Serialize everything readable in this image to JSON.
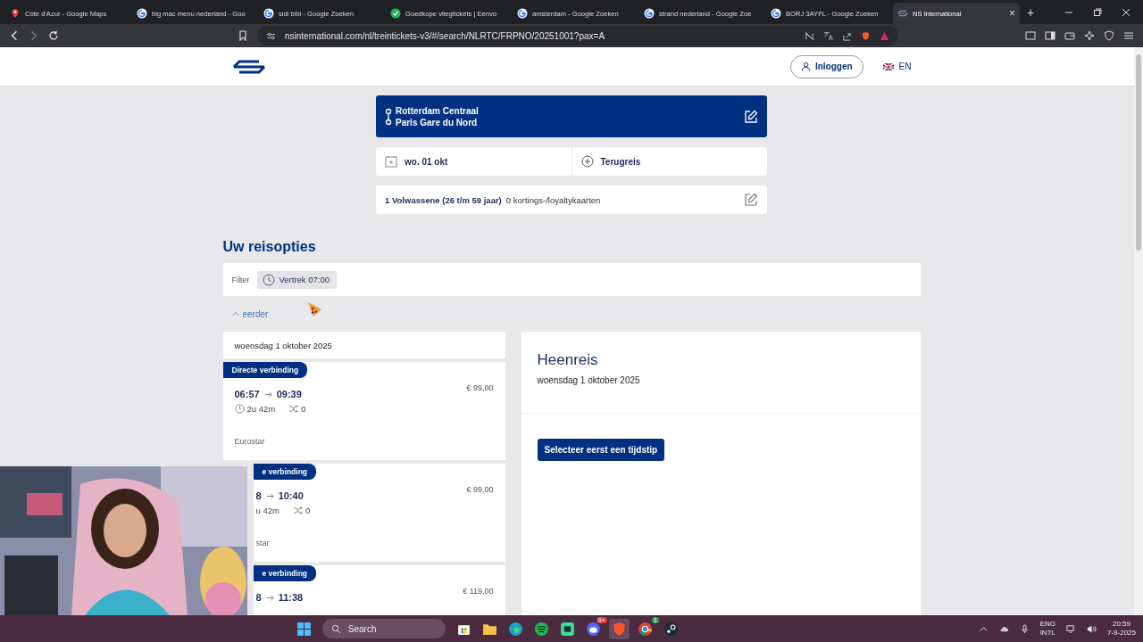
{
  "browser": {
    "tabs": [
      {
        "kind": "maps",
        "title": "Côte d'Azur - Google Maps",
        "selected": false
      },
      {
        "kind": "google",
        "title": "big mac menu nederland - Goo",
        "selected": false
      },
      {
        "kind": "google",
        "title": "sidi bibi - Google Zoeken",
        "selected": false
      },
      {
        "kind": "deal",
        "title": "Goedkope vliegtickets | Eenvo",
        "selected": false
      },
      {
        "kind": "google",
        "title": "amsterdam - Google Zoeken",
        "selected": false
      },
      {
        "kind": "google",
        "title": "strand nederland - Google Zoe",
        "selected": false
      },
      {
        "kind": "google",
        "title": "BORJ 3AYFL - Google Zoeken",
        "selected": false
      },
      {
        "kind": "ns",
        "title": "NS International",
        "selected": true
      }
    ],
    "new_tab": "+",
    "close_tab": "×",
    "url": "nsinternational.com/nl/treintickets-v3/#/search/NLRTC/FRPNO/20251001?pax=A"
  },
  "header": {
    "login": "Inloggen",
    "language": "EN"
  },
  "trip": {
    "from": "Rotterdam Centraal",
    "to": "Paris Gare du Nord",
    "date": "wo. 01 okt",
    "return": "Terugreis",
    "passengers": "1 Volwassene (26 t/m 59 jaar)",
    "cards": "0 kortings-/loyaltykaarten"
  },
  "results": {
    "title": "Uw reisopties",
    "filter_label": "Filter",
    "filter_chip": "Vertrek 07:00",
    "earlier": "eerder",
    "day": "woensdag 1 oktober 2025",
    "journeys": [
      {
        "kind": "full",
        "badge": "Directe verbinding",
        "depart": "06:57",
        "arrive": "09:39",
        "duration": "2u 42m",
        "transfers": "0",
        "operator": "Eurostar",
        "price": "€ 99,00"
      },
      {
        "kind": "cut",
        "badge": "e verbinding",
        "depart": "8",
        "arrive": "10:40",
        "duration": "u 42m",
        "transfers": "0",
        "operator": "star",
        "price": "€ 99,00"
      },
      {
        "kind": "cut",
        "badge": "e verbinding",
        "depart": "8",
        "arrive": "11:38",
        "price": "€ 119,00"
      }
    ]
  },
  "detail": {
    "title": "Heenreis",
    "date": "woensdag 1 oktober 2025",
    "hint": "Selecteer eerst een tijdstip"
  },
  "taskbar": {
    "search": "Search",
    "discord_badge": "9+",
    "chrome_badge": "1",
    "language": "ENG",
    "layout": "INTL",
    "time": "20:59",
    "date": "7-9-2025"
  }
}
